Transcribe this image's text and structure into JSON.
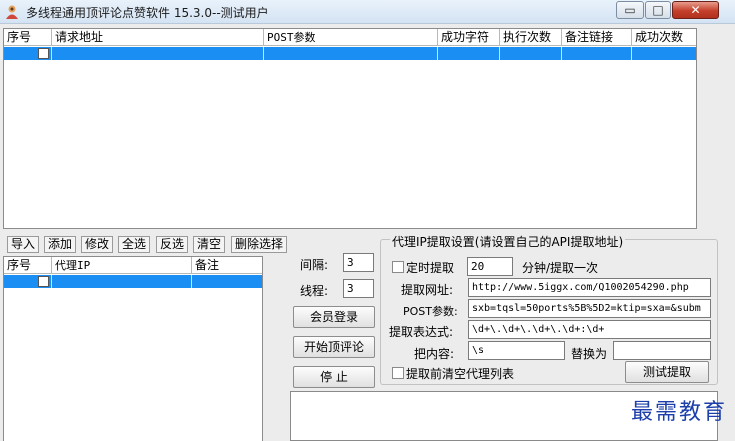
{
  "window": {
    "title": "多线程通用顶评论点赞软件 15.3.0--测试用户",
    "minimize": "▭",
    "maximize": "□",
    "close": "✕"
  },
  "request_table": {
    "columns": [
      "序号",
      "请求地址",
      "POST参数",
      "成功字符",
      "执行次数",
      "备注链接",
      "成功次数"
    ]
  },
  "toolbar": {
    "import": "导入",
    "add": "添加",
    "edit": "修改",
    "select_all": "全选",
    "invert": "反选",
    "clear": "清空",
    "delete_selected": "删除选择"
  },
  "proxy_table": {
    "columns": [
      "序号",
      "代理IP",
      "备注"
    ]
  },
  "controls": {
    "interval_label": "间隔:",
    "interval_value": "3",
    "threads_label": "线程:",
    "threads_value": "3",
    "login_button": "会员登录",
    "start_button": "开始顶评论",
    "stop_button": "停  止"
  },
  "proxy_settings": {
    "group_title": "代理IP提取设置(请设置自己的API提取地址)",
    "timed_label": "定时提取",
    "timed_value": "20",
    "timed_unit": "分钟/提取一次",
    "url_label": "提取网址:",
    "url_value": "http://www.5iggx.com/Q1002054290.php",
    "post_label": "POST参数:",
    "post_value": "sxb=tqsl=50ports%5B%5D2=ktip=sxa=&subm",
    "regex_label": "提取表达式:",
    "regex_value": "\\d+\\.\\d+\\.\\d+\\.\\d+:\\d+",
    "replace_label": "把内容:",
    "replace_value": "\\s",
    "replace_with_label": "替换为",
    "replace_with_value": "",
    "clear_before_label": "提取前清空代理列表",
    "test_button": "测试提取"
  },
  "watermark": "最需教育"
}
